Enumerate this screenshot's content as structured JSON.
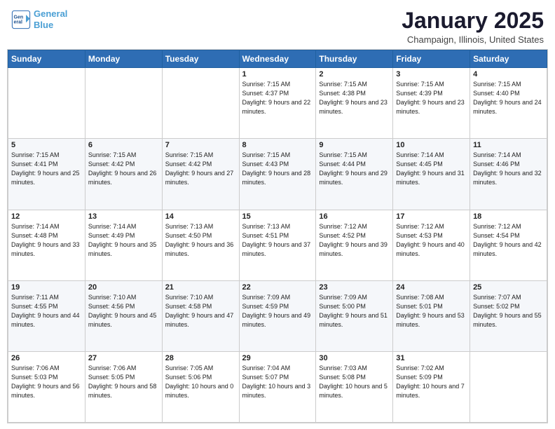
{
  "header": {
    "logo_line1": "General",
    "logo_line2": "Blue",
    "month": "January 2025",
    "location": "Champaign, Illinois, United States"
  },
  "weekdays": [
    "Sunday",
    "Monday",
    "Tuesday",
    "Wednesday",
    "Thursday",
    "Friday",
    "Saturday"
  ],
  "weeks": [
    [
      {
        "day": "",
        "info": ""
      },
      {
        "day": "",
        "info": ""
      },
      {
        "day": "",
        "info": ""
      },
      {
        "day": "1",
        "info": "Sunrise: 7:15 AM\nSunset: 4:37 PM\nDaylight: 9 hours and 22 minutes."
      },
      {
        "day": "2",
        "info": "Sunrise: 7:15 AM\nSunset: 4:38 PM\nDaylight: 9 hours and 23 minutes."
      },
      {
        "day": "3",
        "info": "Sunrise: 7:15 AM\nSunset: 4:39 PM\nDaylight: 9 hours and 23 minutes."
      },
      {
        "day": "4",
        "info": "Sunrise: 7:15 AM\nSunset: 4:40 PM\nDaylight: 9 hours and 24 minutes."
      }
    ],
    [
      {
        "day": "5",
        "info": "Sunrise: 7:15 AM\nSunset: 4:41 PM\nDaylight: 9 hours and 25 minutes."
      },
      {
        "day": "6",
        "info": "Sunrise: 7:15 AM\nSunset: 4:42 PM\nDaylight: 9 hours and 26 minutes."
      },
      {
        "day": "7",
        "info": "Sunrise: 7:15 AM\nSunset: 4:42 PM\nDaylight: 9 hours and 27 minutes."
      },
      {
        "day": "8",
        "info": "Sunrise: 7:15 AM\nSunset: 4:43 PM\nDaylight: 9 hours and 28 minutes."
      },
      {
        "day": "9",
        "info": "Sunrise: 7:15 AM\nSunset: 4:44 PM\nDaylight: 9 hours and 29 minutes."
      },
      {
        "day": "10",
        "info": "Sunrise: 7:14 AM\nSunset: 4:45 PM\nDaylight: 9 hours and 31 minutes."
      },
      {
        "day": "11",
        "info": "Sunrise: 7:14 AM\nSunset: 4:46 PM\nDaylight: 9 hours and 32 minutes."
      }
    ],
    [
      {
        "day": "12",
        "info": "Sunrise: 7:14 AM\nSunset: 4:48 PM\nDaylight: 9 hours and 33 minutes."
      },
      {
        "day": "13",
        "info": "Sunrise: 7:14 AM\nSunset: 4:49 PM\nDaylight: 9 hours and 35 minutes."
      },
      {
        "day": "14",
        "info": "Sunrise: 7:13 AM\nSunset: 4:50 PM\nDaylight: 9 hours and 36 minutes."
      },
      {
        "day": "15",
        "info": "Sunrise: 7:13 AM\nSunset: 4:51 PM\nDaylight: 9 hours and 37 minutes."
      },
      {
        "day": "16",
        "info": "Sunrise: 7:12 AM\nSunset: 4:52 PM\nDaylight: 9 hours and 39 minutes."
      },
      {
        "day": "17",
        "info": "Sunrise: 7:12 AM\nSunset: 4:53 PM\nDaylight: 9 hours and 40 minutes."
      },
      {
        "day": "18",
        "info": "Sunrise: 7:12 AM\nSunset: 4:54 PM\nDaylight: 9 hours and 42 minutes."
      }
    ],
    [
      {
        "day": "19",
        "info": "Sunrise: 7:11 AM\nSunset: 4:55 PM\nDaylight: 9 hours and 44 minutes."
      },
      {
        "day": "20",
        "info": "Sunrise: 7:10 AM\nSunset: 4:56 PM\nDaylight: 9 hours and 45 minutes."
      },
      {
        "day": "21",
        "info": "Sunrise: 7:10 AM\nSunset: 4:58 PM\nDaylight: 9 hours and 47 minutes."
      },
      {
        "day": "22",
        "info": "Sunrise: 7:09 AM\nSunset: 4:59 PM\nDaylight: 9 hours and 49 minutes."
      },
      {
        "day": "23",
        "info": "Sunrise: 7:09 AM\nSunset: 5:00 PM\nDaylight: 9 hours and 51 minutes."
      },
      {
        "day": "24",
        "info": "Sunrise: 7:08 AM\nSunset: 5:01 PM\nDaylight: 9 hours and 53 minutes."
      },
      {
        "day": "25",
        "info": "Sunrise: 7:07 AM\nSunset: 5:02 PM\nDaylight: 9 hours and 55 minutes."
      }
    ],
    [
      {
        "day": "26",
        "info": "Sunrise: 7:06 AM\nSunset: 5:03 PM\nDaylight: 9 hours and 56 minutes."
      },
      {
        "day": "27",
        "info": "Sunrise: 7:06 AM\nSunset: 5:05 PM\nDaylight: 9 hours and 58 minutes."
      },
      {
        "day": "28",
        "info": "Sunrise: 7:05 AM\nSunset: 5:06 PM\nDaylight: 10 hours and 0 minutes."
      },
      {
        "day": "29",
        "info": "Sunrise: 7:04 AM\nSunset: 5:07 PM\nDaylight: 10 hours and 3 minutes."
      },
      {
        "day": "30",
        "info": "Sunrise: 7:03 AM\nSunset: 5:08 PM\nDaylight: 10 hours and 5 minutes."
      },
      {
        "day": "31",
        "info": "Sunrise: 7:02 AM\nSunset: 5:09 PM\nDaylight: 10 hours and 7 minutes."
      },
      {
        "day": "",
        "info": ""
      }
    ]
  ]
}
